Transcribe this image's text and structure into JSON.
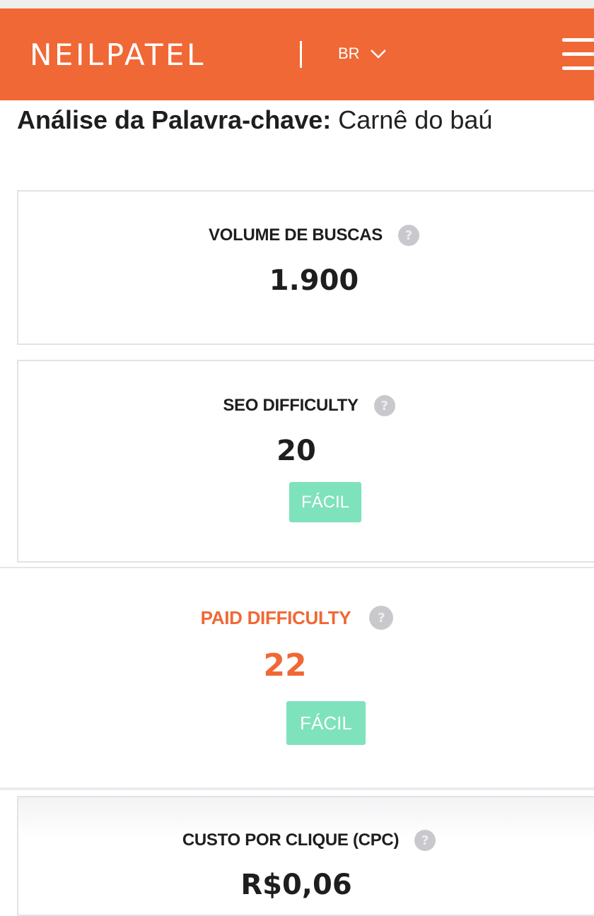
{
  "header": {
    "logo": "NEILPATEL",
    "language": "BR",
    "accent_color": "#f06835"
  },
  "page": {
    "title_label": "Análise da Palavra-chave:",
    "title_keyword": "Carnê do baú"
  },
  "metrics": {
    "search_volume": {
      "label": "VOLUME DE BUSCAS",
      "value": "1.900"
    },
    "seo_difficulty": {
      "label": "SEO DIFFICULTY",
      "value": "20",
      "badge": "FÁCIL"
    },
    "paid_difficulty": {
      "label": "PAID DIFFICULTY",
      "value": "22",
      "badge": "FÁCIL",
      "color": "#f06835"
    },
    "cpc": {
      "label": "CUSTO POR CLIQUE (CPC)",
      "value": "R$0,06"
    }
  },
  "icons": {
    "help": "help-circle-icon",
    "menu": "hamburger-menu-icon",
    "dropdown": "chevron-down-icon"
  },
  "help_glyph": "?",
  "badge_color": "#7ee2bd"
}
